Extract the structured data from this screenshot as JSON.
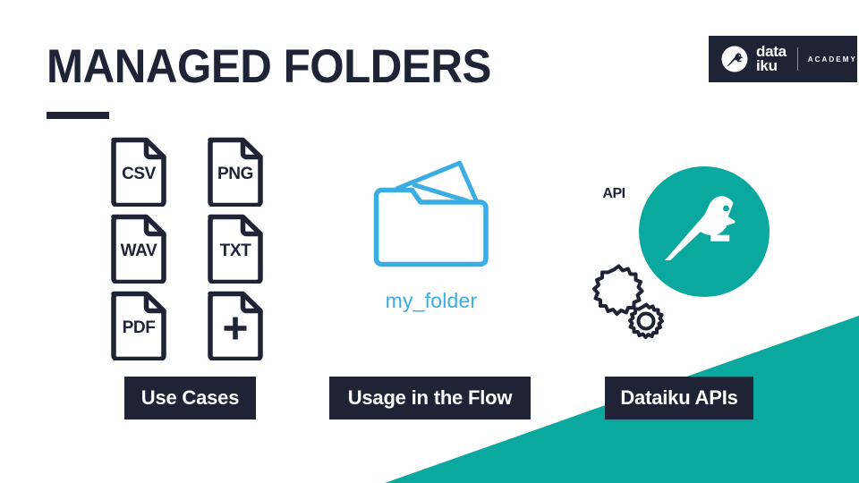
{
  "slide": {
    "title": "MANAGED FOLDERS",
    "background_color": "#ffffff",
    "accent_teal": "#0aa89e",
    "accent_navy": "#1e2435",
    "accent_blue": "#3aaee2"
  },
  "brand": {
    "mark_icon": "dataiku-bird-icon",
    "word_line1": "data",
    "word_line2": "iku",
    "sub_label": "ACADEMY"
  },
  "file_icons": [
    {
      "label": "CSV",
      "icon": "file-csv-icon"
    },
    {
      "label": "PNG",
      "icon": "file-png-icon"
    },
    {
      "label": "WAV",
      "icon": "file-wav-icon"
    },
    {
      "label": "TXT",
      "icon": "file-txt-icon"
    },
    {
      "label": "PDF",
      "icon": "file-pdf-icon"
    },
    {
      "label": "+",
      "icon": "file-add-icon"
    }
  ],
  "folder": {
    "icon": "open-folder-icon",
    "label": "my_folder"
  },
  "api": {
    "bird_icon": "dataiku-bird-circle-icon",
    "gears_icon": "gears-icon",
    "gear_label": "API"
  },
  "chips": [
    {
      "label": "Use Cases"
    },
    {
      "label": "Usage in the Flow"
    },
    {
      "label": "Dataiku APIs"
    }
  ]
}
